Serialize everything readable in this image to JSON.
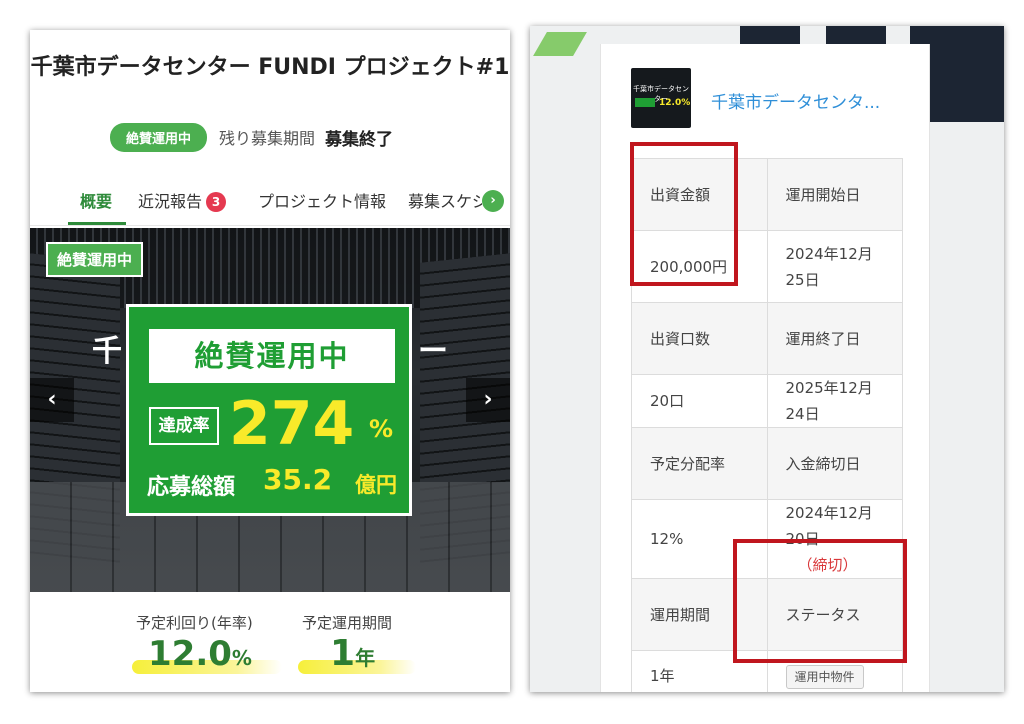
{
  "left": {
    "title": "千葉市データセンター FUNDI プロジェクト#1",
    "status_pill": "絶賛運用中",
    "remaining_label": "残り募集期間",
    "remaining_value": "募集終了",
    "tabs": [
      {
        "label": "概要",
        "active": true
      },
      {
        "label": "近況報告",
        "badge": "3"
      },
      {
        "label": "プロジェクト情報"
      },
      {
        "label": "募集スケジュール"
      }
    ],
    "hero": {
      "tag": "絶賛運用中",
      "ghost_title": "千",
      "ghost_title_right": "ー",
      "card_title": "絶賛運用中",
      "rate_label": "達成率",
      "rate_value": "274",
      "rate_unit": "%",
      "total_label": "応募総額",
      "total_value": "35.2",
      "total_unit": "億円"
    },
    "metrics": [
      {
        "label": "予定利回り(年率)",
        "value": "12.0",
        "unit": "%"
      },
      {
        "label": "予定運用期間",
        "value": "1",
        "unit": "年"
      }
    ],
    "colors": {
      "brand_green": "#4caf50",
      "accent_yellow": "#f8ea2a",
      "badge_red": "#e53950"
    }
  },
  "right": {
    "project_link": "千葉市データセンタ...",
    "thumb": {
      "text": "千葉市データセンター",
      "yield": "12.0%"
    },
    "table": [
      [
        "出資金額",
        "運用開始日"
      ],
      [
        "200,000円",
        "2024年12月25日"
      ],
      [
        "出資口数",
        "運用終了日"
      ],
      [
        "20口",
        "2025年12月24日"
      ],
      [
        "予定分配率",
        "入金締切日"
      ],
      [
        "12%",
        "2024年12月20日"
      ],
      [
        "運用期間",
        "ステータス"
      ],
      [
        "1年",
        "運用中物件"
      ]
    ],
    "closed_note_open": "（",
    "closed_note": "締切",
    "closed_note_close": "）",
    "colors": {
      "link_blue": "#2f8fd8",
      "highlight_red": "#c0161e",
      "closed_red": "#d9383a"
    }
  }
}
